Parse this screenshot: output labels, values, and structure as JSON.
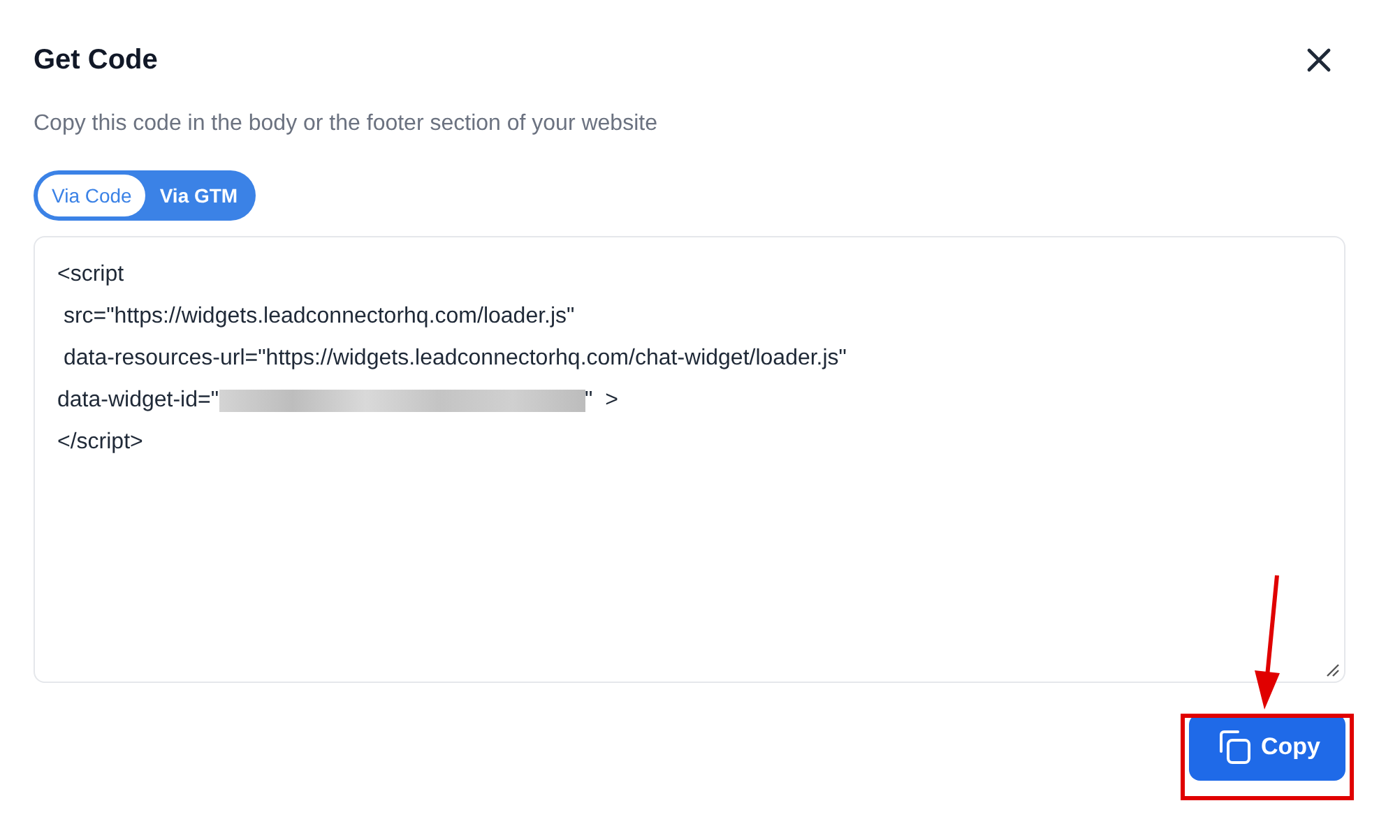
{
  "dialog": {
    "title": "Get Code",
    "subtitle": "Copy this code in the body or the footer section of your website"
  },
  "tabs": [
    {
      "label": "Via Code",
      "selected": true
    },
    {
      "label": "Via GTM",
      "selected": false
    }
  ],
  "code_lines": [
    {
      "kind": "text",
      "text": "<script"
    },
    {
      "kind": "text",
      "text": " src=\"https://widgets.leadconnectorhq.com/loader.js\""
    },
    {
      "kind": "text",
      "text": " data-resources-url=\"https://widgets.leadconnectorhq.com/chat-widget/loader.js\""
    },
    {
      "kind": "redacted",
      "before": "data-widget-id=\"",
      "after": "\"  >"
    },
    {
      "kind": "text",
      "text": "</script>"
    }
  ],
  "copy_button": {
    "label": "Copy"
  }
}
